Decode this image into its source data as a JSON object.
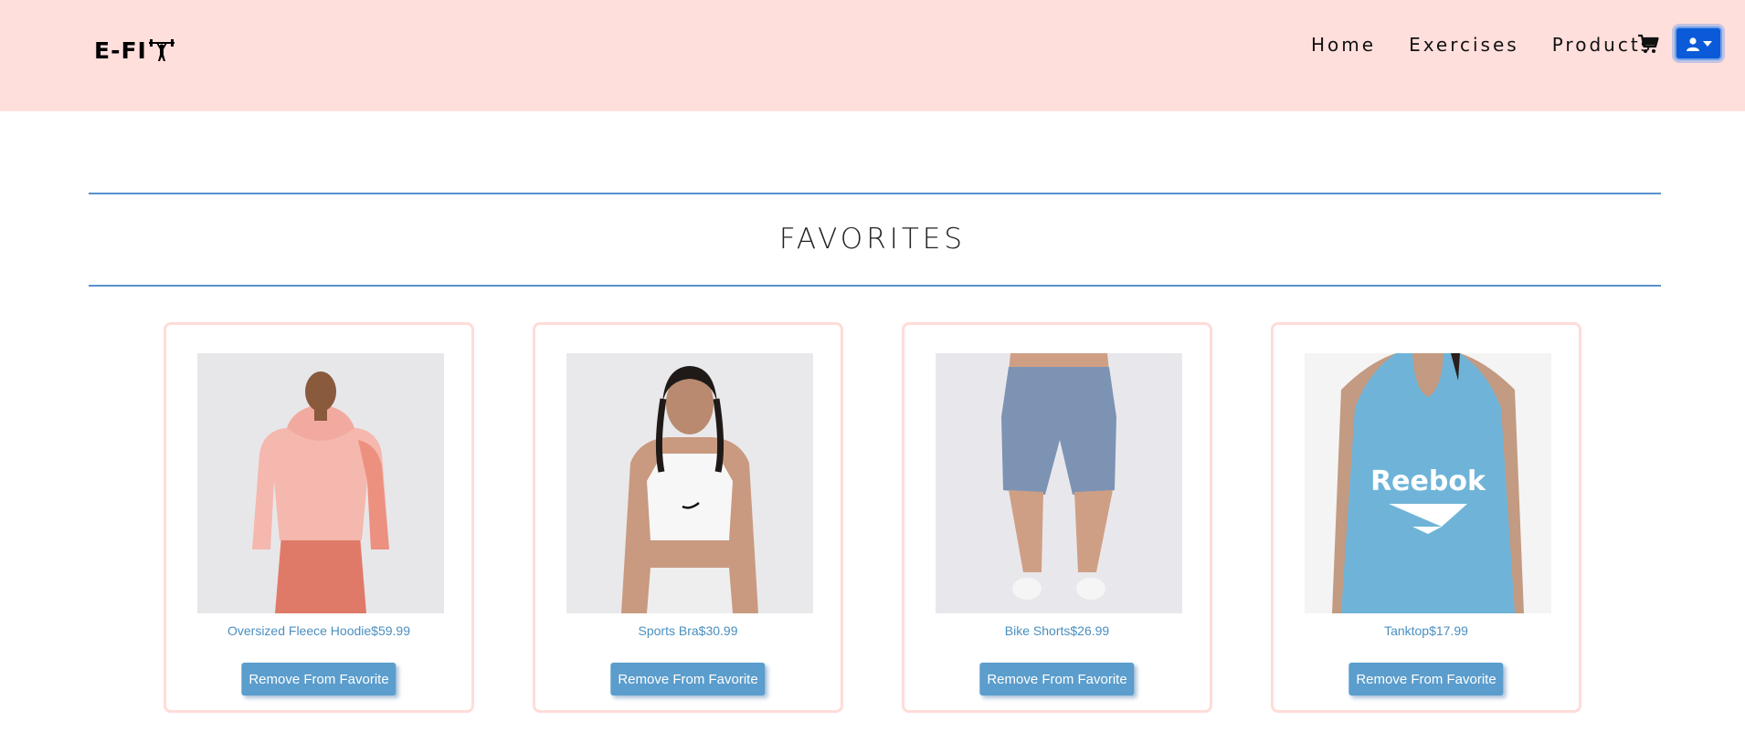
{
  "nav": {
    "logo_text": "E-FI",
    "links": [
      "Home",
      "Exercises",
      "Products"
    ]
  },
  "page": {
    "title": "FAVORITES"
  },
  "favorites": [
    {
      "name": "Oversized Fleece Hoodie",
      "price": "$59.99",
      "button": "Remove From Favorite"
    },
    {
      "name": "Sports Bra",
      "price": "$30.99",
      "button": "Remove From Favorite"
    },
    {
      "name": "Bike Shorts",
      "price": "$26.99",
      "button": "Remove From Favorite"
    },
    {
      "name": "Tanktop",
      "price": "$17.99",
      "button": "Remove From Favorite"
    }
  ],
  "colors": {
    "navbar_bg": "#ffdfdc",
    "accent_blue": "#5b9dcc",
    "divider": "#3d7ec6",
    "user_button": "#0b5ad9"
  }
}
